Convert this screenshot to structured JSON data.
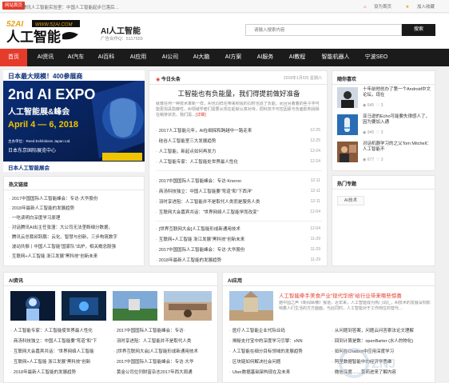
{
  "topbar": {
    "badge": "网站首页",
    "message": "腾讯人工智能实验室：中国人工智能起步已落后…",
    "links": [
      "设为首页",
      "加入收藏"
    ]
  },
  "header": {
    "logo_text": "人工智能",
    "logo_url": "WWW.52AI.COM",
    "site_title": "AI人工智能",
    "site_sub": "广告合作Q：5117555",
    "search_placeholder": "请输入搜索内容",
    "search_button": "搜索"
  },
  "nav": [
    "首页",
    "AI资讯",
    "AI汽车",
    "AI百科",
    "AI应用",
    "AI公司",
    "AI大脑",
    "AI方案",
    "AI服务",
    "AI教程",
    "智能机器人",
    "宁波SEO"
  ],
  "banner": {
    "top": "日本最大规模！400参展商",
    "title1": "2nd AI EXPO",
    "title2": "人工智能展&峰会",
    "dates": "April 4 — 6, 2018",
    "venue": "主办单位：Reed Exhibitions Japan Ltd.",
    "place": "日本东京国际展览中心",
    "bottom": "日本人工智能展会"
  },
  "hot": {
    "title": "热文链接",
    "items": [
      "2017中国国际人工智能峰会：专访·大华股份",
      "2018年最新人工智能的发展趋势",
      "一吃读明白深度学习原理",
      "对话腾讯AI出主任张潼：大公司无法垄断细分数据，",
      "腾讯云总裁邱跃鹏：云化、智慧与创新，三步构筑数字",
      "波动共振丨中国人工智能“国家队”出炉，相关概念股强",
      "互联网+人工智能 浙江发展“黑科技”创新未来"
    ]
  },
  "today": {
    "title": "今日头条",
    "date": "2018年1月6日 星期六",
    "headline": "工智能也有负能量，我们得提前做好准备",
    "summary": "就像任何一种技术革新一样，AI也同样在带来积极的同时也造了负能。而且另着着的些子学可能更加具隐蔽性，AI领域学者们需要从现在起就认真对待，把科技不可控因素与负面影响消除在萌芽状态，我们需…",
    "summary_more": "[详细]",
    "list1": [
      [
        "2017人工智能元年，AI在细探和跨越中一路走来",
        "12-25"
      ],
      [
        "硅谷人工智能室三大发展趋势",
        "12-25"
      ],
      [
        "人工智能，新起点如何再发力",
        "12-24"
      ],
      [
        "人工智能专家：人工智能处世界最人性化",
        "12-24"
      ]
    ],
    "list2": [
      [
        "2017中国国际人工智能峰会：专访·Kneron",
        "12-11"
      ],
      [
        "商汤科技独立：中国人工智能要“弯道”和“下西洋”",
        "12-11"
      ],
      [
        "羽时享进阻：人工智能并不是取代人类而是服务人类",
        "12-11"
      ],
      [
        "互联网大会嘉宾共话：“世界网络人工智能学而改变”",
        "12-04"
      ]
    ],
    "list3": [
      [
        "[世界互联网大会]人工智能形成新通用技术",
        "12-04"
      ],
      [
        "互联网+人工智能 浙江发展“黑科技”创新未来",
        "11-29"
      ],
      [
        "2017中国国际人工智能峰会：专访·大华股份",
        "11-29"
      ],
      [
        "2018年最新人工智能的发展趋势",
        "11-29"
      ]
    ]
  },
  "recommend": {
    "title": "随你喜欢",
    "items": [
      {
        "title": "十年前他创办了第一个Android中文论坛，现在",
        "views": "645",
        "likes": "3"
      },
      {
        "title": "亚马逊的Echo可能要失律感人了，因为要加入通",
        "views": "945",
        "likes": "3"
      },
      {
        "title": "对话机器学习的之父Tom Mitchell：人工智能不",
        "views": "677",
        "likes": "3"
      }
    ]
  },
  "topics": {
    "title": "热门专题",
    "chip": "AI技术"
  },
  "ai_news": {
    "title": "AI资讯",
    "col1": [
      "人工智能专家：人工智能使世界最人性化",
      "商汤科技独立：中国人工智能要“弯道”和“下",
      "互联网大会嘉宾共话：“世界网络人工智能",
      "互联网+人工智能 浙江发展“黑科技”创新",
      "2018年最新人工智能的发展趋势"
    ],
    "col2": [
      "2017中国国际人工智能峰会：专访·",
      "羽时享进阻：人工智能并不是取代人类",
      "[世界互联网大会]人工智能形成新通用技术",
      "2017中国国际人工智能峰会：专访·大华",
      "黄金公司位列财富杂志2017年西大周通"
    ]
  },
  "ai_app": {
    "title": "AI应用",
    "headline": "人工智能牵手美食产业“现代华焙”给行业带来哪些惊喜",
    "summary": "据中国之声《新闻纵横》报道，近年来，人工智能成为热门词汇，AI技术的发展深刻影响着人们生活的方方面面，与此同时，人工智能对于工作岗位的替代…",
    "col1": [
      "医疗人工智能企业代际业码",
      "揭秘支付宝中的深度学习引擎：xNN",
      "人工智能在细分目标领域的发展趋势",
      "区块链如何解决社会问题",
      "Uber数据基础架构现在及未来"
    ],
    "col2": [
      "从问题到答案，问题云问答索法论文理解",
      "回到计算是数：openBarter (水人的物化)",
      "如何在Chatbot中应用深度学习",
      "阿里数据智能中的经济学思维",
      "微信深度……莫莉进来了解内容"
    ]
  },
  "watermark": "ZNJ"
}
